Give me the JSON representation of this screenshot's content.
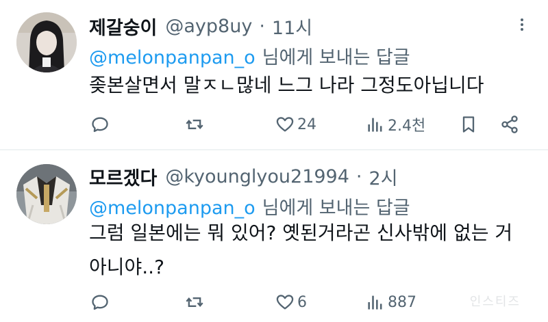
{
  "tweets": [
    {
      "name": "제갈숭이",
      "handle": "@ayp8uy",
      "separator": "·",
      "time": "11시",
      "reply_to_handle": "@melonpanpan_o",
      "reply_to_suffix": "님에게 보내는 답글",
      "text_lines": [
        "좆본살면서 말ㅈㄴ많네 느그 나라 그정도아닙니다"
      ],
      "counts": {
        "reply": "",
        "retweet": "",
        "like": "24",
        "views": "2.4천"
      }
    },
    {
      "name": "모르겠다",
      "handle": "@kyounglyou21994",
      "separator": "·",
      "time": "2시",
      "reply_to_handle": "@melonpanpan_o",
      "reply_to_suffix": "님에게 보내는 답글",
      "text_lines": [
        "그럼 일본에는 뭐 있어? 옛된거라곤 신사밖에 없는 거",
        "아니야..?"
      ],
      "counts": {
        "reply": "",
        "retweet": "",
        "like": "6",
        "views": "887"
      }
    }
  ],
  "icons": {
    "reply": "speech-bubble-icon",
    "retweet": "retweet-arrows-icon",
    "like": "heart-icon",
    "views": "bar-chart-icon",
    "bookmark": "bookmark-icon",
    "share": "share-nodes-icon",
    "more": "more-dots-icon"
  },
  "colors": {
    "text": "#0f1419",
    "secondary": "#536471",
    "accent": "#1d9bf0",
    "divider": "#eff3f4"
  },
  "watermark": "인스티즈"
}
